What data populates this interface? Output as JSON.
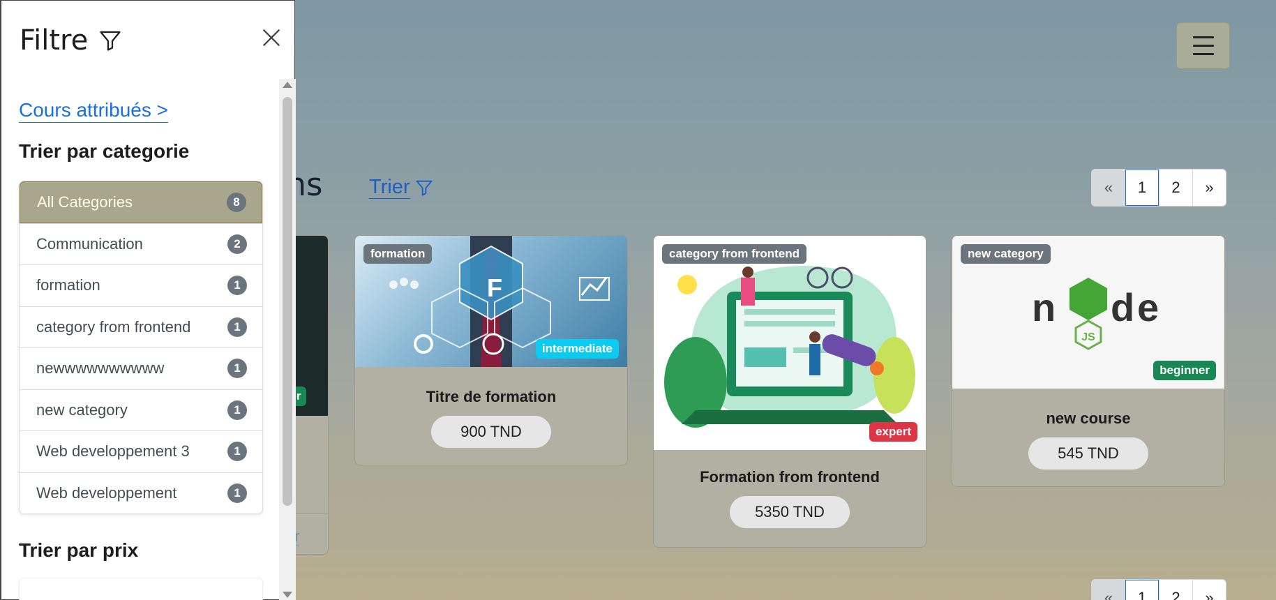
{
  "header": {
    "menu_icon": "hamburger-icon"
  },
  "main": {
    "section_title_partial": "ons",
    "sort_label": "Trier",
    "sort_icon": "filter-icon",
    "pagination": {
      "prev": "«",
      "pages": [
        "1",
        "2"
      ],
      "next": "»",
      "active": "1"
    },
    "partial_card": {
      "level_fragment": "ner",
      "button_fragment": "ier"
    },
    "courses": [
      {
        "category": "formation",
        "level": "intermediate",
        "level_color": "#0dcaf0",
        "title": "Titre de formation",
        "price": "900 TND"
      },
      {
        "category": "category from frontend",
        "level": "expert",
        "level_color": "#dc3545",
        "title": "Formation from frontend",
        "price": "5350 TND"
      },
      {
        "category": "new category",
        "level": "beginner",
        "level_color": "#198754",
        "title": "new course",
        "price": "545 TND"
      }
    ]
  },
  "filter_panel": {
    "title": "Filtre",
    "title_icon": "filter-icon",
    "close_icon": "close-icon",
    "assigned_link": "Cours attribués >",
    "category_heading": "Trier par categorie",
    "categories": [
      {
        "label": "All Categories",
        "count": "8",
        "active": true
      },
      {
        "label": "Communication",
        "count": "2"
      },
      {
        "label": "formation",
        "count": "1"
      },
      {
        "label": "category from frontend",
        "count": "1"
      },
      {
        "label": "newwwwwwwwww",
        "count": "1"
      },
      {
        "label": "new category",
        "count": "1"
      },
      {
        "label": "Web developpement 3",
        "count": "1"
      },
      {
        "label": "Web developpement",
        "count": "1"
      }
    ],
    "price_heading": "Trier par prix"
  }
}
